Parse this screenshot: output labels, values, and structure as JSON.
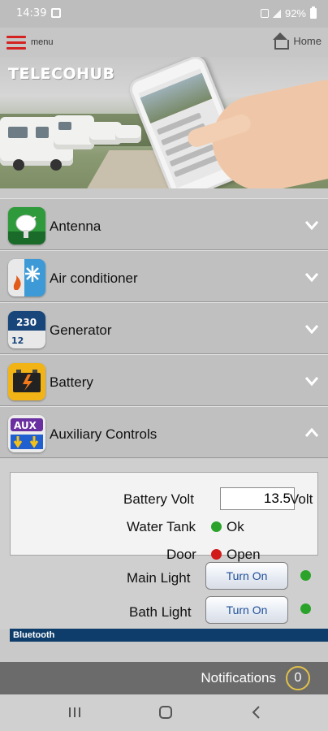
{
  "status_bar": {
    "time": "14:39",
    "battery": "92%"
  },
  "header": {
    "menu_label": "menu",
    "home_label": "Home"
  },
  "banner": {
    "logo_left": "TELECO",
    "logo_right": "HUB"
  },
  "accordion": [
    {
      "label": "Antenna",
      "state": "collapsed",
      "icon": "antenna-icon"
    },
    {
      "label": "Air conditioner",
      "state": "collapsed",
      "icon": "air-conditioner-icon"
    },
    {
      "label": "Generator",
      "state": "collapsed",
      "icon": "generator-icon"
    },
    {
      "label": "Battery",
      "state": "collapsed",
      "icon": "battery-icon"
    },
    {
      "label": "Auxiliary Controls",
      "state": "expanded",
      "icon": "aux-icon"
    }
  ],
  "aux_controls": {
    "battery_volt_label": "Battery Volt",
    "battery_volt_value": "13.5",
    "battery_volt_unit": "Volt",
    "water_tank_label": "Water Tank",
    "water_tank_status": "Ok",
    "door_label": "Door",
    "door_status": "Open",
    "main_light_label": "Main Light",
    "main_light_button": "Turn On",
    "bath_light_label": "Bath Light",
    "bath_light_button": "Turn On"
  },
  "bluetooth_label": "Bluetooth",
  "notifications": {
    "label": "Notifications",
    "count": "0"
  },
  "colors": {
    "ok": "#2ba32b",
    "alert": "#d11b1b",
    "bluetooth_bar": "#0f3d6b",
    "menu_red": "#d42222"
  }
}
